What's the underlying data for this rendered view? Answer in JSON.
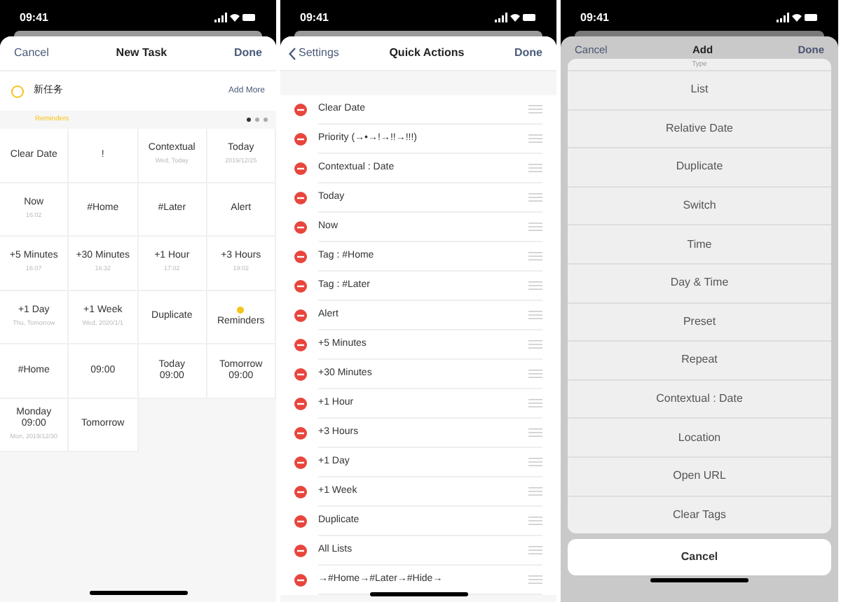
{
  "screens": [
    {
      "status_time": "09:41",
      "nav": {
        "left": "Cancel",
        "title": "New Task",
        "right": "Done"
      },
      "task": {
        "value": "新任务",
        "add_more": "Add More"
      },
      "section": {
        "label": "Reminders",
        "pages": [
          {
            "selected": true
          },
          {
            "selected": false
          },
          {
            "selected": false
          }
        ]
      },
      "grid": [
        {
          "title": "Clear Date"
        },
        {
          "title": "!"
        },
        {
          "title": "Contextual",
          "subtitle": "Wed, Today"
        },
        {
          "title": "Today",
          "subtitle": "2019/12/25"
        },
        {
          "title": "Now",
          "subtitle": "16:02"
        },
        {
          "title": "#Home"
        },
        {
          "title": "#Later"
        },
        {
          "title": "Alert"
        },
        {
          "title": "+5 Minutes",
          "subtitle": "16:07"
        },
        {
          "title": "+30 Minutes",
          "subtitle": "16:32"
        },
        {
          "title": "+1 Hour",
          "subtitle": "17:02"
        },
        {
          "title": "+3 Hours",
          "subtitle": "19:02"
        },
        {
          "title": "+1 Day",
          "subtitle": "Thu, Tomorrow"
        },
        {
          "title": "+1 Week",
          "subtitle": "Wed, 2020/1/1"
        },
        {
          "title": "Duplicate"
        },
        {
          "title": "Reminders",
          "color": "#f5c518"
        },
        {
          "title": "#Home"
        },
        {
          "title": "09:00"
        },
        {
          "title": "Today\n09:00"
        },
        {
          "title": "Tomorrow\n09:00"
        },
        {
          "title": "Monday\n09:00",
          "subtitle": "Mon, 2019/12/30"
        },
        {
          "title": "Tomorrow"
        }
      ]
    },
    {
      "status_time": "09:41",
      "nav": {
        "back": "Settings",
        "title": "Quick Actions",
        "right": "Done"
      },
      "actions": [
        "Clear Date",
        "Priority (→•→!→!!→!!!)",
        "Contextual : Date",
        "Today",
        "Now",
        "Tag : #Home",
        "Tag : #Later",
        "Alert",
        "+5 Minutes",
        "+30 Minutes",
        "+1 Hour",
        "+3 Hours",
        "+1 Day",
        "+1 Week",
        "Duplicate",
        "All Lists",
        "→#Home→#Later→#Hide→"
      ]
    },
    {
      "status_time": "09:41",
      "nav": {
        "left": "Cancel",
        "title": "Add",
        "right": "Done"
      },
      "sheet": {
        "title": "Type",
        "options": [
          "List",
          "Relative Date",
          "Duplicate",
          "Switch",
          "Time",
          "Day & Time",
          "Preset",
          "Repeat",
          "Contextual : Date",
          "Location",
          "Open URL",
          "Clear Tags"
        ],
        "cancel": "Cancel"
      }
    }
  ]
}
